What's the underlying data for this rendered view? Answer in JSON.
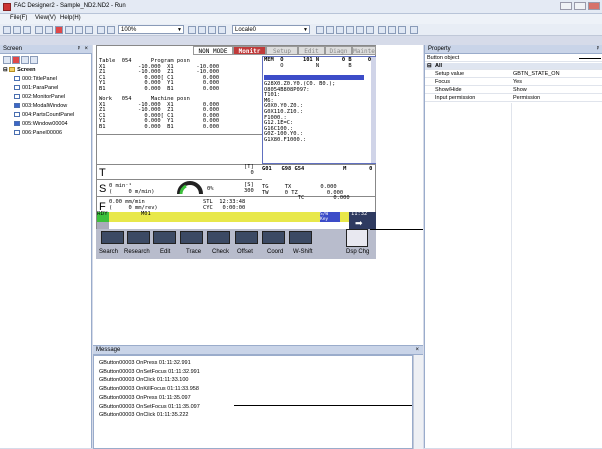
{
  "window": {
    "title": "FAC Designer2 - Sample_ND2.ND2 - Run"
  },
  "menu": [
    {
      "label": "File(F)"
    },
    {
      "label": "View(V)"
    },
    {
      "label": "Help(H)"
    }
  ],
  "toolbar": {
    "zoom": "100%",
    "locale": "Locale0"
  },
  "screen_panel": {
    "title": "Screen",
    "close": "×",
    "pin": "ᵖ",
    "root": "Screen",
    "items": [
      {
        "label": "000:TitlePanel"
      },
      {
        "label": "001:ParaPanel"
      },
      {
        "label": "002:MonitorPanel"
      },
      {
        "label": "003:ModalWindow"
      },
      {
        "label": "004:PartsCountPanel"
      },
      {
        "label": "005:Window00004"
      },
      {
        "label": "006:Panel00006"
      }
    ]
  },
  "cnc": {
    "mode": "NON MODE",
    "tabs": [
      {
        "label": "Monitr"
      },
      {
        "label": "Setup"
      },
      {
        "label": "Edit"
      },
      {
        "label": "Diagn"
      },
      {
        "label": "Mainte"
      }
    ],
    "program_block": "Table  054      Program posn\nX1          -10.000  X1       -10.000\nZ1          -10.000  Z1       -10.000\nC1            0.000[ C1         0.000\nY1            0.000  Y1         0.000\nB1            0.000  B1         0.000",
    "machine_block": "Work   054      Machine posn\nX1          -10.000  X1         0.000\nZ1          -10.000  Z1         0.000\nC1            0.000[ C1         0.000\nY1            0.000  Y1         0.000\nB1            0.000  B1         0.000",
    "mem_header": "MEM  O      101 N       0 B     0",
    "mem_sub": "     O          N         B",
    "program_text": "G28X0.Z0.Y0.(C0. B0.);\nO8054B808P097:\nT101:\nM6:\nG0X0.Y0.Z0.:\nG0X110.Z10.:\nF1000.:\nG12.1E=C:\nG16C100.:\nG0Z-100.Y0.:\nG1X80.F1000.:",
    "t_label": "T",
    "t_code": "[T]\n0",
    "s_label": "S",
    "s_value": "0 min⁻¹\n(     0 m/min)",
    "s_pct": "0%",
    "s_code": "[S]\n300",
    "f_label": "F",
    "f_value": "0.00 mm/min\n(     0 mm/rev)",
    "stl": "STL  12:33:48\nCYC   0:00:00",
    "g_header": "G01   G98 G54            M       0",
    "tool_offset": "TG     TX         0.000\nTW     0 TZ         0.000\n           TC         0.000",
    "status_rdy": "RDY",
    "status_code": "M01",
    "sw_key": "S/W\nKey",
    "time": "11:32",
    "softkeys": [
      {
        "label": "Search"
      },
      {
        "label": "Research"
      },
      {
        "label": "Edit"
      },
      {
        "label": "Trace"
      },
      {
        "label": "Check"
      },
      {
        "label": "Offset"
      },
      {
        "label": "Coord"
      },
      {
        "label": "W-Shift"
      },
      {
        "label": "Dsp Chg"
      }
    ]
  },
  "message_panel": {
    "title": "Message",
    "close": "×",
    "lines": [
      {
        "text": "GButton00003 OnPress 01:11:32.991"
      },
      {
        "text": "GButton00003 OnSetFocus 01:11:32.991"
      },
      {
        "text": "GButton00003 OnClick 01:11:33.100"
      },
      {
        "text": "GButton00003 OnKillFocus 01:11:33.958"
      },
      {
        "text": "GButton00003 OnPress 01:11:35.097"
      },
      {
        "text": "GButton00003 OnSetFocus 01:11:35.097"
      },
      {
        "text": "GButton00003 OnClick 01:11:35.222"
      }
    ]
  },
  "property_panel": {
    "title": "Property",
    "pin": "ᵖ",
    "object": "Button object",
    "group": "All",
    "rows": [
      {
        "key": "Setup value",
        "value": "GBTN_STATE_ON"
      },
      {
        "key": "Focus",
        "value": "Yes"
      },
      {
        "key": "Show/Hide",
        "value": "Show"
      },
      {
        "key": "Input permission",
        "value": "Permission"
      }
    ]
  },
  "colors": {
    "accent": "#c03a3a",
    "panel_header": "#c9d4e8",
    "status_bar": "#e8e84a",
    "rdy": "#3cc03c"
  }
}
